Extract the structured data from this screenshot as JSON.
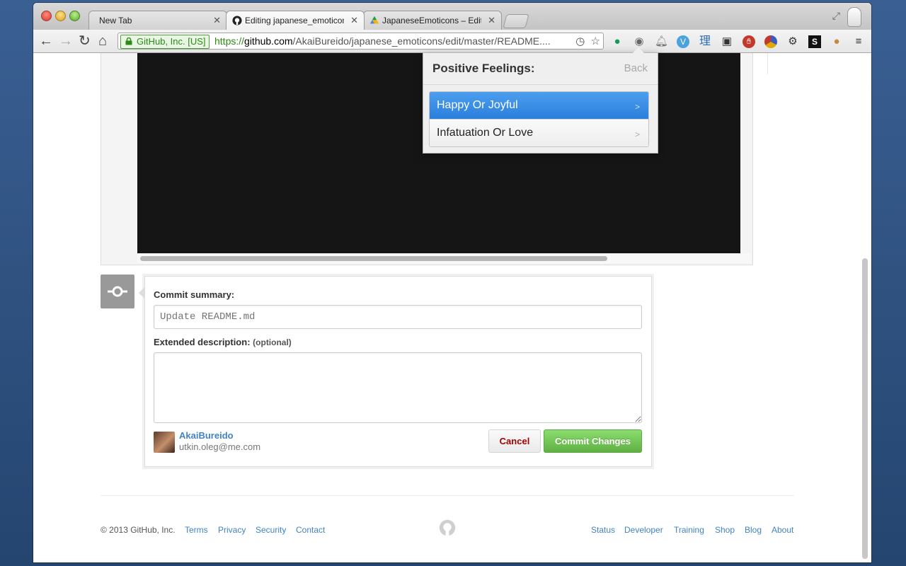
{
  "browser": {
    "tabs": [
      {
        "title": "New Tab"
      },
      {
        "title": "Editing japanese_emoticons"
      },
      {
        "title": "JapaneseEmoticons – Edit"
      }
    ],
    "ev_label": "GitHub, Inc. [US]",
    "url_scheme": "https://",
    "url_host": "github.com",
    "url_path": "/AkaiBureido/japanese_emoticons/edit/master/README...."
  },
  "popup": {
    "title": "Positive Feelings:",
    "back_label": "Back",
    "items": [
      {
        "label": "Happy Or Joyful",
        "selected": true
      },
      {
        "label": "Infatuation Or Love",
        "selected": false
      }
    ],
    "chevron": ">"
  },
  "commit": {
    "summary_label": "Commit summary:",
    "summary_placeholder": "Update README.md",
    "description_label": "Extended description:",
    "description_optional": "(optional)",
    "user_name": "AkaiBureido",
    "user_email": "utkin.oleg@me.com",
    "cancel_label": "Cancel",
    "commit_label": "Commit Changes"
  },
  "footer": {
    "copyright": "© 2013 GitHub, Inc.",
    "left_links": [
      "Terms",
      "Privacy",
      "Security",
      "Contact"
    ],
    "right_links": [
      "Status",
      "Developer",
      "Training",
      "Shop",
      "Blog",
      "About"
    ]
  },
  "colors": {
    "link": "#4183c4",
    "commit_button": "#60b044",
    "cancel_text": "#a30000",
    "selected_item": "#2a7fdc",
    "editor_background": "#151515"
  }
}
